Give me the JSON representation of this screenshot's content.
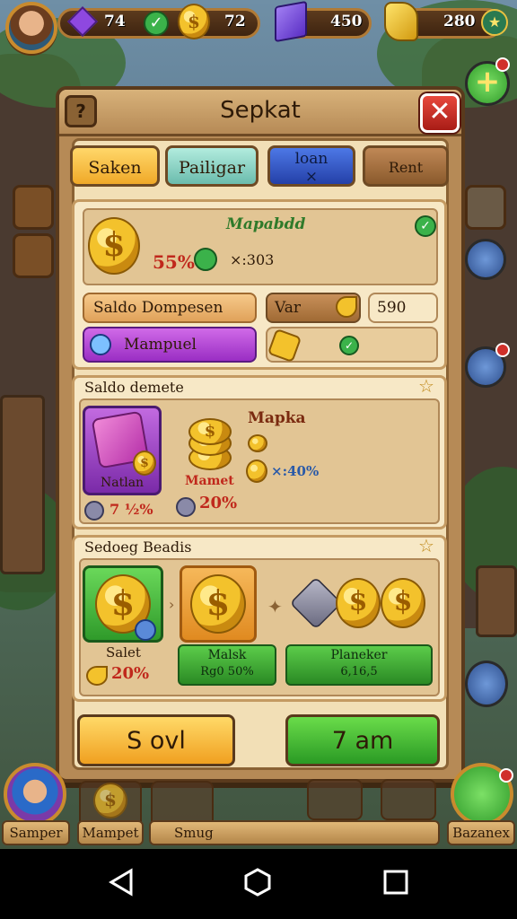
{
  "hud": {
    "gem_value": "74",
    "coin_value": "72",
    "crystal_value": "450",
    "gold_value": "280"
  },
  "panel": {
    "title": "Sepkat",
    "help": "?",
    "close": "✕"
  },
  "tabs": [
    {
      "label": "Saken",
      "color": "#f5c04a"
    },
    {
      "label": "Pailigar",
      "color": "#8fd0c0"
    },
    {
      "label": "loan\n×",
      "color": "#2f56c8"
    },
    {
      "label": "Rent",
      "color": "#b07a44"
    }
  ],
  "section1": {
    "heading": "Mapabdd",
    "percent": "55%",
    "amount": "×:303",
    "saldo_label": "Saldo Dompesen",
    "var_label": "Var",
    "var_value": "590",
    "purple_label": "Mampuel"
  },
  "section2": {
    "heading": "Saldo demete",
    "item_label": "Natlan",
    "item_value": "7 ½%",
    "mid_label": "Mamet",
    "mid_value": "20%",
    "right_heading": "Mapka",
    "right_value": "×:40%"
  },
  "section3": {
    "heading": "Sedoeg Beadis",
    "card1_label": "Salet",
    "card1_value": "20%",
    "card2_title": "Malsk",
    "card2_value": "Rg0 50%",
    "card3_title": "Planeker",
    "card3_value": "6,16,5"
  },
  "buttons": {
    "left": "S ovl",
    "right": "7 am"
  },
  "bottom_hud": {
    "left_label": "Samper",
    "mid_label": "Mampet",
    "center_label": "Smug",
    "right_label": "Bazanex"
  }
}
